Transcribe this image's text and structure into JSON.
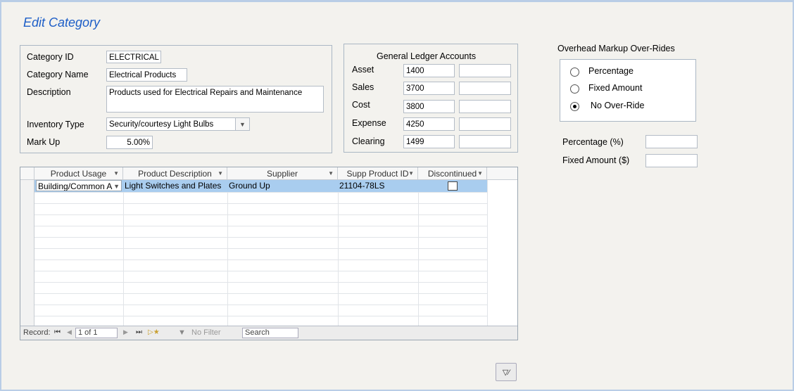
{
  "form_title": "Edit Category",
  "category": {
    "id_label": "Category ID",
    "id_value": "ELECTRICAL",
    "name_label": "Category Name",
    "name_value": "Electrical Products",
    "desc_label": "Description",
    "desc_value": "Products used for Electrical Repairs and Maintenance",
    "inv_label": "Inventory Type",
    "inv_value": "Security/courtesy Light Bulbs",
    "markup_label": "Mark Up",
    "markup_value": "5.00%"
  },
  "gl": {
    "title": "General Ledger Accounts",
    "rows": [
      {
        "label": "Asset",
        "value": "1400",
        "extra": ""
      },
      {
        "label": "Sales",
        "value": "3700",
        "extra": ""
      },
      {
        "label": "Cost",
        "value": "3800",
        "extra": ""
      },
      {
        "label": "Expense",
        "value": "4250",
        "extra": ""
      },
      {
        "label": "Clearing",
        "value": "1499",
        "extra": ""
      }
    ]
  },
  "overhead": {
    "title": "Overhead Markup Over-Rides",
    "options": [
      {
        "label": "Percentage",
        "selected": false
      },
      {
        "label": "Fixed Amount",
        "selected": false
      },
      {
        "label": "No Over-Ride",
        "selected": true
      }
    ],
    "percentage_label": "Percentage (%)",
    "percentage_value": "",
    "fixed_label": "Fixed Amount ($)",
    "fixed_value": ""
  },
  "grid": {
    "columns": [
      "Product Usage",
      "Product Description",
      "Supplier",
      "Supp Product ID",
      "Discontinued"
    ],
    "rows": [
      {
        "usage": "Building/Common A",
        "description": "Light Switches and Plates",
        "supplier": "Ground Up",
        "supp_id": "21104-78LS",
        "discontinued": false
      }
    ]
  },
  "nav": {
    "record_label": "Record:",
    "position": "1 of 1",
    "filter_label": "No Filter",
    "search_placeholder": "Search"
  },
  "colors": {
    "title": "#1d5ec7",
    "selected_row": "#a9cdef",
    "frame": "#b9cde6"
  }
}
